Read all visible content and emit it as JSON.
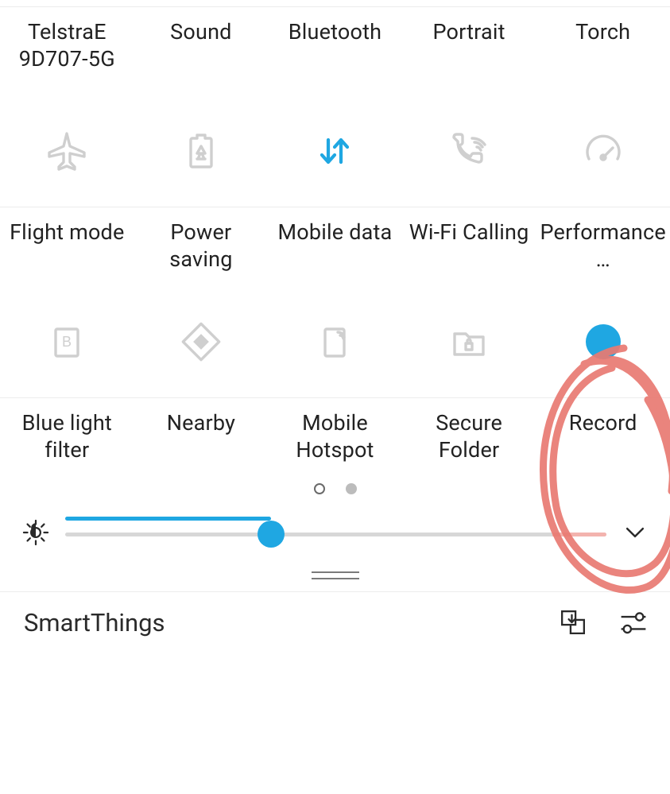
{
  "rows": [
    {
      "tiles": [
        {
          "id": "wifi",
          "label": "TelstraE 9D707-5G",
          "active": false
        },
        {
          "id": "sound",
          "label": "Sound",
          "active": false
        },
        {
          "id": "bluetooth",
          "label": "Bluetooth",
          "active": false
        },
        {
          "id": "portrait",
          "label": "Portrait",
          "active": false
        },
        {
          "id": "torch",
          "label": "Torch",
          "active": false
        }
      ]
    },
    {
      "tiles": [
        {
          "id": "flight",
          "label": "Flight mode",
          "active": false
        },
        {
          "id": "power",
          "label": "Power saving",
          "active": false
        },
        {
          "id": "mobiledata",
          "label": "Mobile data",
          "active": true
        },
        {
          "id": "wificalling",
          "label": "Wi-Fi Calling",
          "active": false
        },
        {
          "id": "performance",
          "label": "Performance…",
          "active": false
        }
      ]
    },
    {
      "tiles": [
        {
          "id": "bluelight",
          "label": "Blue light filter",
          "active": false
        },
        {
          "id": "nearby",
          "label": "Nearby",
          "active": false
        },
        {
          "id": "hotspot",
          "label": "Mobile Hotspot",
          "active": false
        },
        {
          "id": "secure",
          "label": "Secure Folder",
          "active": false
        },
        {
          "id": "record",
          "label": "Record",
          "active": true
        }
      ]
    }
  ],
  "pager": {
    "current": 0,
    "total": 2
  },
  "brightness": {
    "value_pct": 38,
    "auto_tail_pct": 10
  },
  "bottom": {
    "title": "SmartThings"
  },
  "colors": {
    "accent": "#1fa7e2",
    "icon_off": "#cfcfcf",
    "annotation": "#e97a72"
  },
  "annotation": {
    "target_tile": "record",
    "style": "hand-circle"
  }
}
